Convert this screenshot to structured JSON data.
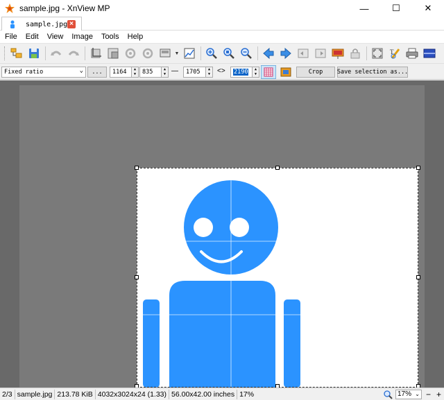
{
  "window": {
    "title": "sample.jpg - XnView MP",
    "minimize": "—",
    "maximize": "☐",
    "close": "✕"
  },
  "tab": {
    "label": "sample.jpg",
    "close": "×"
  },
  "menu": [
    "File",
    "Edit",
    "View",
    "Image",
    "Tools",
    "Help"
  ],
  "toolbar": {
    "icons": [
      "browser-icon",
      "save-icon",
      "undo-icon",
      "redo-icon",
      "crop-icon",
      "resize-icon",
      "rotate-left-icon",
      "rotate-right-icon",
      "adjust-icon",
      "levels-icon",
      "zoom-in-icon",
      "zoom-fit-icon",
      "zoom-out-icon",
      "previous-icon",
      "next-icon",
      "first-icon",
      "last-icon",
      "slideshow-icon",
      "lock-icon",
      "fullscreen-icon",
      "edit-text-icon",
      "print-icon",
      "settings-icon"
    ]
  },
  "crop": {
    "ratio_mode": "Fixed ratio",
    "more_label": "...",
    "x_value": "1164",
    "y_value": "835",
    "dash": "—",
    "width_value": "1705",
    "swap_symbol": "<>",
    "height_value": "2190",
    "crop_label": "Crop",
    "save_selection_label": "Save selection as..."
  },
  "status": {
    "index": "2/3",
    "filename": "sample.jpg",
    "filesize": "213.78 KiB",
    "dimensions": "4032x3024x24 (1.33)",
    "print_size": "56.00x42.00 inches",
    "zoom_percent": "17%",
    "zoom_field": "17%"
  },
  "colors": {
    "figure_blue": "#2b93ff",
    "canvas_dark": "#696969",
    "canvas_light": "#7a7a7a",
    "tab_close_red": "#e0503a"
  }
}
